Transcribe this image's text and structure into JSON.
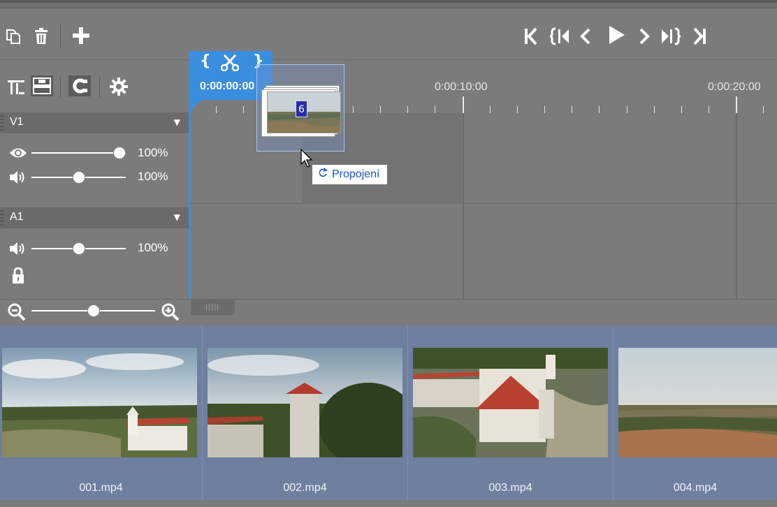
{
  "toolbar": {
    "copy_icon": "copy-icon",
    "delete_icon": "trash-icon",
    "add_icon": "plus-icon"
  },
  "transport": {
    "buttons": [
      "go-to-start",
      "previous-marker",
      "previous-frame",
      "play",
      "next-frame",
      "next-marker",
      "go-to-end"
    ]
  },
  "tools": {
    "icons": [
      "split-track-icon",
      "track-mode-icon",
      "magnet-icon",
      "gear-icon"
    ]
  },
  "playhead": {
    "time": "0:00:00:00",
    "icons": [
      "in-bracket-icon",
      "scissors-icon",
      "out-bracket-icon"
    ]
  },
  "ruler": {
    "labels": [
      "0:00:10:00",
      "0:00:20:00"
    ]
  },
  "tracks": {
    "v1": {
      "name": "V1",
      "visibility_pct": "100%",
      "volume_pct": "100%",
      "visibility_level": 1.0,
      "volume_level": 0.5
    },
    "a1": {
      "name": "A1",
      "volume_pct": "100%",
      "volume_level": 0.5,
      "locked": true
    }
  },
  "drag": {
    "count": "6",
    "tooltip": "Propojení"
  },
  "zoom": {
    "level": 0.5
  },
  "bin": {
    "clips": [
      {
        "name": "001.mp4"
      },
      {
        "name": "002.mp4"
      },
      {
        "name": "003.mp4"
      },
      {
        "name": "004.mp4"
      }
    ]
  },
  "colors": {
    "accent": "#3a8ee0",
    "panel": "#7b7b7b",
    "bin": "#6e7fa0",
    "tooltip_text": "#1a4fc9"
  }
}
